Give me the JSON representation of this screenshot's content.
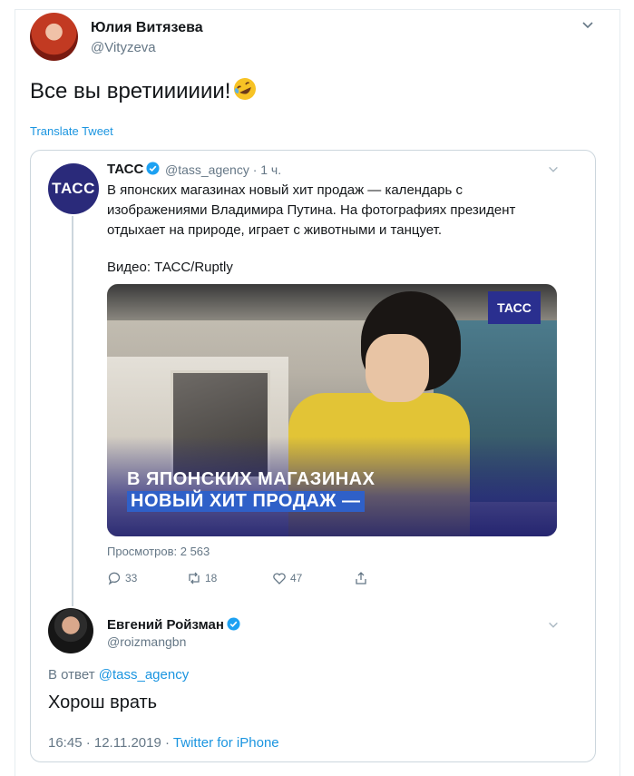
{
  "tweet": {
    "author_name": "Юлия Витязева",
    "author_handle": "@Vityzeva",
    "text": "Все вы вретииииии!",
    "emoji": "rolling-on-floor-laughing",
    "translate_label": "Translate Tweet"
  },
  "quoted": {
    "avatar_text": "ТАСС",
    "name": "ТАСС",
    "handle_time": "@tass_agency · 1 ч.",
    "text": "В японских магазинах новый хит продаж — календарь с изображениями Владимира Путина. На фотографиях президент отдыхает на природе, играет с животными и танцует.",
    "video_credit": "Видео: ТАСС/Ruptly",
    "media": {
      "badge": "ТАСС",
      "caption_line1": "В ЯПОНСКИХ МАГАЗИНАХ",
      "caption_line2": "НОВЫЙ ХИТ ПРОДАЖ —"
    },
    "views": "Просмотров: 2 563",
    "actions": {
      "replies": "33",
      "retweets": "18",
      "likes": "47"
    }
  },
  "reply": {
    "name": "Евгений Ройзман",
    "handle": "@roizmangbn",
    "reply_prefix": "В ответ",
    "reply_to_handle": "@tass_agency",
    "text": "Хорош врать",
    "timestamp": "16:45 · 12.11.2019 ·",
    "client": "Twitter for iPhone"
  },
  "colors": {
    "link": "#1b95e0",
    "muted": "#657786",
    "verified": "#1da1f2",
    "tass_brand": "#2a2a7a"
  }
}
